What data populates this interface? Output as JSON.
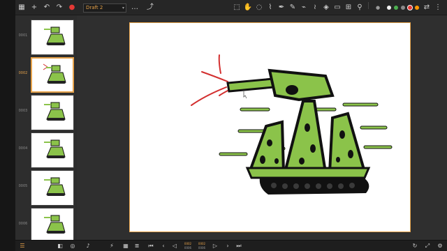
{
  "toolbar": {
    "scene_name": "Draft 2",
    "left_icons": [
      "grid-icon",
      "add-icon",
      "undo-icon",
      "redo-icon",
      "record-icon"
    ],
    "right_icons": [
      "select-icon",
      "hand-icon",
      "lasso-icon",
      "brush-icon",
      "pen-icon",
      "pencil-icon",
      "marker-icon",
      "smudge-icon",
      "fill-icon",
      "eraser-icon",
      "shape-icon",
      "eyedropper-icon"
    ],
    "colors": [
      "#f2f2f2",
      "#4caf50",
      "#8a8a8a",
      "#e53935",
      "#ff9800"
    ],
    "color_labels": [
      "1",
      "12"
    ]
  },
  "frames": [
    {
      "number": "0001",
      "active": false
    },
    {
      "number": "0002",
      "active": true
    },
    {
      "number": "0003",
      "active": false
    },
    {
      "number": "0004",
      "active": false
    },
    {
      "number": "0005",
      "active": false
    },
    {
      "number": "0006",
      "active": false
    }
  ],
  "bottombar": {
    "left_icons": [
      "layers-icon",
      "camera-icon",
      "onion-icon",
      "audio-icon"
    ],
    "playback_icons": [
      "first-frame-icon",
      "prev-keyframe-icon",
      "prev-frame-icon",
      "play-icon",
      "next-frame-icon",
      "last-frame-icon"
    ],
    "counter_left": {
      "value": "0002",
      "sub": "0006"
    },
    "counter_right": {
      "value": "0002",
      "sub": "0006"
    },
    "right_icons": [
      "loop-icon",
      "settings-icon"
    ]
  }
}
